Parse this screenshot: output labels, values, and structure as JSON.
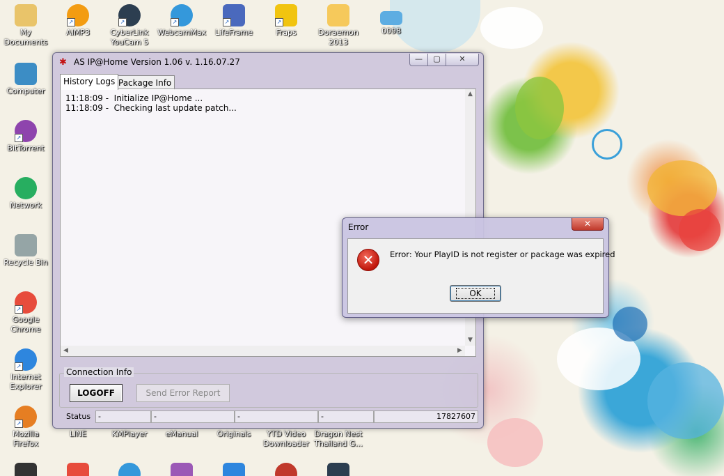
{
  "desktop": {
    "icons": [
      {
        "label": "My\nDocuments",
        "icon": "folder-user-icon",
        "color": "#e9c46a"
      },
      {
        "label": "AIMP3",
        "icon": "aimp-icon",
        "color": "#f39c12"
      },
      {
        "label": "CyberLink\nYouCam 5",
        "icon": "webcam-icon",
        "color": "#2c3e50"
      },
      {
        "label": "WebcamMax",
        "icon": "webcam-icon",
        "color": "#3498db"
      },
      {
        "label": "LifeFrame",
        "icon": "lifeframe-icon",
        "color": "#4a69bd"
      },
      {
        "label": "Fraps",
        "icon": "fraps-icon",
        "color": "#f1c40f"
      },
      {
        "label": "Doraemon\n2013",
        "icon": "folder-icon",
        "color": "#f6c95b"
      },
      {
        "label": "0098",
        "icon": "text-file-icon",
        "color": "#5dade2"
      },
      {
        "label": "Computer",
        "icon": "computer-icon",
        "color": "#3c8dc5"
      },
      {
        "label": "BitTorrent",
        "icon": "bittorrent-icon",
        "color": "#8e44ad"
      },
      {
        "label": "Network",
        "icon": "network-icon",
        "color": "#27ae60"
      },
      {
        "label": "Recycle Bin",
        "icon": "recycle-bin-icon",
        "color": "#95a5a6"
      },
      {
        "label": "Google\nChrome",
        "icon": "chrome-icon",
        "color": "#e74c3c"
      },
      {
        "label": "Internet\nExplorer",
        "icon": "internet-explorer-icon",
        "color": "#2e86de"
      },
      {
        "label": "Mozilla\nFirefox",
        "icon": "firefox-icon",
        "color": "#e67e22"
      },
      {
        "label": "LINE",
        "icon": "line-icon",
        "color": "#2ecc71"
      },
      {
        "label": "KMPlayer",
        "icon": "kmplayer-icon",
        "color": "#34495e"
      },
      {
        "label": "eManual",
        "icon": "emanual-icon",
        "color": "#2980b9"
      },
      {
        "label": "Originals",
        "icon": "originals-icon",
        "color": "#c0392b"
      },
      {
        "label": "YTD Video\nDownloader",
        "icon": "ytd-icon",
        "color": "#e74c3c"
      },
      {
        "label": "Dragon Nest\nThailand G...",
        "icon": "dragon-nest-icon",
        "color": "#7f8c8d"
      }
    ],
    "bottom_icons": [
      {
        "icon": "camera-icon",
        "color": "#333333"
      },
      {
        "icon": "pdf-icon",
        "color": "#e74c3c"
      },
      {
        "icon": "globe-icon",
        "color": "#3498db"
      },
      {
        "icon": "app-icon",
        "color": "#9b59b6"
      },
      {
        "icon": "shark-icon",
        "color": "#2e86de"
      },
      {
        "icon": "no-entry-icon",
        "color": "#c0392b"
      },
      {
        "icon": "film-icon",
        "color": "#2c3e50"
      }
    ]
  },
  "main_window": {
    "title": "AS IP@Home Version  1.06  v. 1.16.07.27",
    "caption_buttons": {
      "minimize": "—",
      "maximize": "▢",
      "close": "✕"
    },
    "tabs": [
      {
        "label": "History Logs",
        "active": true
      },
      {
        "label": "Package Info",
        "active": false
      }
    ],
    "log_lines": [
      "11:18:09 -  Initialize IP@Home ...",
      "11:18:09 -  Checking last update patch..."
    ],
    "connection_info": {
      "label": "Connection Info",
      "logoff_label": "LOGOFF",
      "send_error_label": "Send Error Report"
    },
    "status": {
      "label": "Status",
      "fields": [
        "-",
        "-",
        "-",
        "-"
      ],
      "value": "17827607"
    }
  },
  "error_dialog": {
    "title": "Error",
    "close_glyph": "✕",
    "message": "Error: Your PlayID is not register or package was expired",
    "icon_glyph": "✕",
    "ok_label": "OK"
  }
}
